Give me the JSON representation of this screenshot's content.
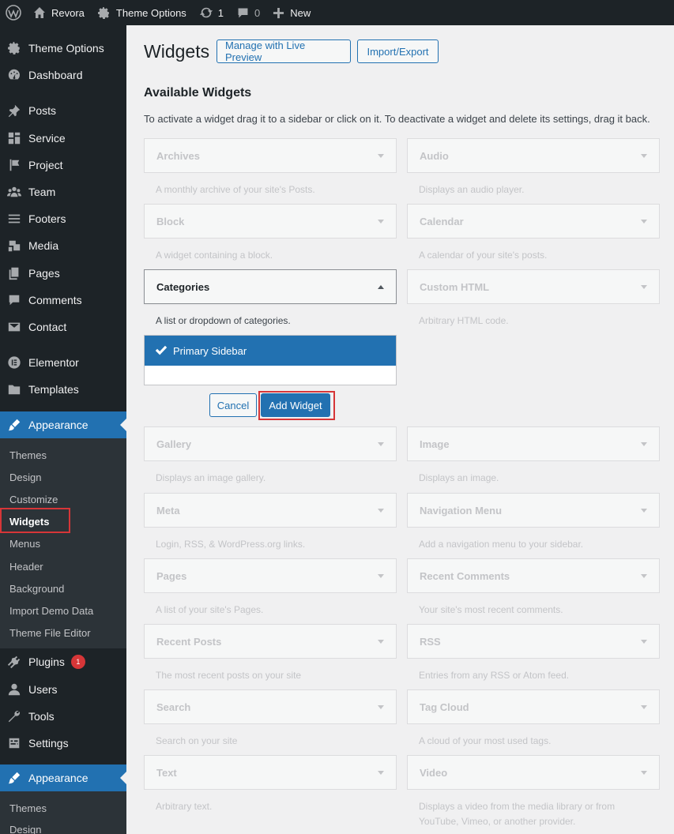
{
  "admin_bar": {
    "site_name": "Revora",
    "theme_options": "Theme Options",
    "updates_count": "1",
    "comments_count": "0",
    "new_label": "New"
  },
  "sidebar": {
    "items": [
      {
        "label": "Theme Options",
        "icon": "gear-icon"
      },
      {
        "label": "Dashboard",
        "icon": "dashboard-icon"
      },
      {
        "label": "Posts",
        "icon": "pin-icon"
      },
      {
        "label": "Service",
        "icon": "grid-icon"
      },
      {
        "label": "Project",
        "icon": "flag-icon"
      },
      {
        "label": "Team",
        "icon": "team-icon"
      },
      {
        "label": "Footers",
        "icon": "list-icon"
      },
      {
        "label": "Media",
        "icon": "media-icon"
      },
      {
        "label": "Pages",
        "icon": "pages-icon"
      },
      {
        "label": "Comments",
        "icon": "comment-icon"
      },
      {
        "label": "Contact",
        "icon": "mail-icon"
      },
      {
        "label": "Elementor",
        "icon": "elementor-icon"
      },
      {
        "label": "Templates",
        "icon": "folder-icon"
      },
      {
        "label": "Appearance",
        "icon": "brush-icon"
      },
      {
        "label": "Plugins",
        "icon": "plugin-icon",
        "badge": "1"
      },
      {
        "label": "Users",
        "icon": "user-icon"
      },
      {
        "label": "Tools",
        "icon": "wrench-icon"
      },
      {
        "label": "Settings",
        "icon": "settings-icon"
      },
      {
        "label": "Appearance",
        "icon": "brush-icon"
      }
    ],
    "appearance_submenu": [
      "Themes",
      "Design",
      "Customize",
      "Widgets",
      "Menus",
      "Header",
      "Background",
      "Import Demo Data",
      "Theme File Editor"
    ],
    "appearance_submenu_2": [
      "Themes",
      "Design"
    ]
  },
  "main": {
    "title": "Widgets",
    "manage_live_preview": "Manage with Live Preview",
    "import_export": "Import/Export",
    "section_title": "Available Widgets",
    "description": "To activate a widget drag it to a sidebar or click on it. To deactivate a widget and delete its settings, drag it back.",
    "widgets": [
      {
        "name": "Archives",
        "desc": "A monthly archive of your site's Posts."
      },
      {
        "name": "Audio",
        "desc": "Displays an audio player."
      },
      {
        "name": "Block",
        "desc": "A widget containing a block."
      },
      {
        "name": "Calendar",
        "desc": "A calendar of your site's posts."
      },
      {
        "name": "Categories",
        "desc": "A list or dropdown of categories."
      },
      {
        "name": "Custom HTML",
        "desc": "Arbitrary HTML code."
      },
      {
        "name": "Gallery",
        "desc": "Displays an image gallery."
      },
      {
        "name": "Image",
        "desc": "Displays an image."
      },
      {
        "name": "Meta",
        "desc": "Login, RSS, & WordPress.org links."
      },
      {
        "name": "Navigation Menu",
        "desc": "Add a navigation menu to your sidebar."
      },
      {
        "name": "Pages",
        "desc": "A list of your site's Pages."
      },
      {
        "name": "Recent Comments",
        "desc": "Your site's most recent comments."
      },
      {
        "name": "Recent Posts",
        "desc": "The most recent posts on your site"
      },
      {
        "name": "RSS",
        "desc": "Entries from any RSS or Atom feed."
      },
      {
        "name": "Search",
        "desc": "Search on your site"
      },
      {
        "name": "Tag Cloud",
        "desc": "A cloud of your most used tags."
      },
      {
        "name": "Text",
        "desc": "Arbitrary text."
      },
      {
        "name": "Video",
        "desc": "Displays a video from the media library or from YouTube, Vimeo, or another provider."
      }
    ],
    "chooser_selected": "Primary Sidebar",
    "cancel": "Cancel",
    "add_widget": "Add Widget"
  },
  "colors": {
    "admin_dark": "#1d2327",
    "accent": "#2271b1",
    "highlight_red": "#d63638"
  }
}
